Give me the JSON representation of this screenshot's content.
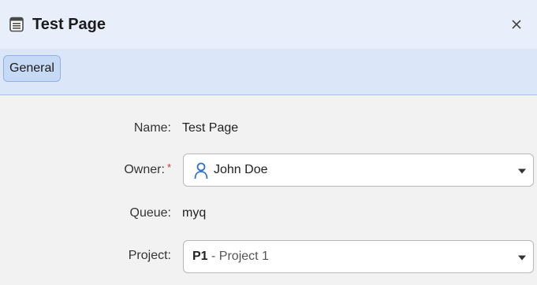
{
  "window": {
    "title": "Test Page",
    "icon": "page-icon",
    "close_label": "✕"
  },
  "tabs": [
    {
      "label": "General",
      "selected": true
    }
  ],
  "form": {
    "name": {
      "label": "Name:",
      "value": "Test Page"
    },
    "owner": {
      "label": "Owner:",
      "required_mark": "*",
      "value": "John Doe",
      "icon": "user-icon"
    },
    "queue": {
      "label": "Queue:",
      "value": "myq"
    },
    "project": {
      "label": "Project:",
      "code": "P1",
      "separator": " - ",
      "name": "Project 1"
    }
  },
  "colors": {
    "titlebar_bg": "#e8effb",
    "tabbar_bg": "#dbe7f8",
    "tab_selected_bg": "#c7daf5",
    "accent": "#2f6fdb",
    "required": "#d9302c"
  }
}
